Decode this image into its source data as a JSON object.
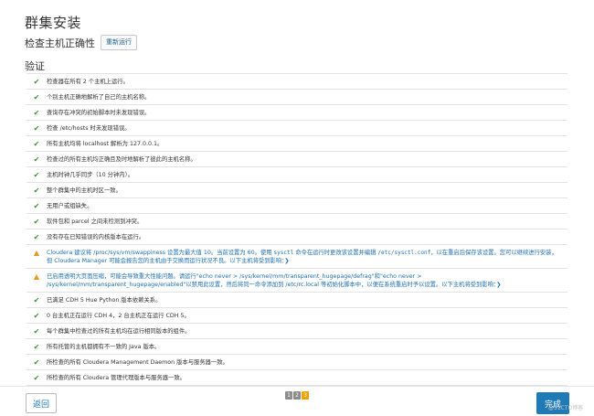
{
  "header": {
    "title": "群集安装",
    "subtitle": "检查主机正确性",
    "rerun_label": "重新运行",
    "section": "验证"
  },
  "checks": [
    {
      "status": "ok",
      "text": "检查器在所有 2 个主机上运行。"
    },
    {
      "status": "ok",
      "text": "个别主机正确地解析了自己的主机名称。"
    },
    {
      "status": "ok",
      "text": "查询存在冲突的初始脚本时未发现错误。"
    },
    {
      "status": "ok",
      "text": "检查 /etc/hosts 时未发现错误。"
    },
    {
      "status": "ok",
      "text": "所有主机均将 localhost 解析为 127.0.0.1。"
    },
    {
      "status": "ok",
      "text": "检查过的所有主机均正确且及时地解析了彼此的主机名称。"
    },
    {
      "status": "ok",
      "text": "主机时钟几乎同步（10 分钟内）。"
    },
    {
      "status": "ok",
      "text": "整个群集中的主机时区一致。"
    },
    {
      "status": "ok",
      "text": "无用户或组缺失。"
    },
    {
      "status": "ok",
      "text": "软件包和 parcel 之间未检测到冲突。"
    },
    {
      "status": "ok",
      "text": "没有存在已知错误的内核版本在运行。"
    },
    {
      "status": "warn",
      "text_a": "Cloudera 建议将 /proc/sys/vm/swappiness 设置为最大值 10。当前设置为 60。使用 ",
      "code_a": "sysctl",
      "text_b": " 命令在运行时更改该设置并编辑 ",
      "code_b": "/etc/sysctl.conf",
      "text_c": "，以在重启后保存该设置。您可以继续进行安装，但 Cloudera Manager 可能会报告您的主机由于交换而运行状况不良。以下主机将受到影响：",
      "more": "❯"
    },
    {
      "status": "warn",
      "text_a": "已启用透明大页面压缩，可能会导致重大性能问题。请运行\"echo never > /sys/kernel/mm/transparent_hugepage/defrag\"和\"echo never > /sys/kernel/mm/transparent_hugepage/enabled\"以禁用此设置，然后将同一命令添加到 /etc/rc.local 等初始化脚本中，以便在系统重启时予以设置。以下主机将受到影响：",
      "more": "❯"
    },
    {
      "status": "ok",
      "text": "已满足 CDH 5 Hue Python 版本依赖关系。"
    },
    {
      "status": "ok",
      "text": "0 台主机正在运行 CDH 4，2 台主机正在运行 CDH 5。"
    },
    {
      "status": "ok",
      "text": "每个群集中检查过的所有主机均在运行相同版本的组件。"
    },
    {
      "status": "ok",
      "text": "所有托管的主机都拥有不一致的 Java 版本。"
    },
    {
      "status": "ok",
      "text": "所检查的所有 Cloudera Management Daemon 版本与服务器一致。"
    },
    {
      "status": "ok",
      "text": "所检查的所有 Cloudera 管理代理版本与服务器一致。"
    }
  ],
  "icons": {
    "ok": "checkmark-icon",
    "warn": "warning-icon"
  },
  "colors": {
    "ok": "#3c8f3c",
    "warn": "#e39a20",
    "link": "#1e6fb0",
    "primary": "#1f7ab5",
    "pager_active": "#f0a000"
  },
  "footer": {
    "back_label": "返回",
    "pages": [
      "1",
      "2",
      "3"
    ],
    "active_page": "3",
    "done_label": "完成",
    "watermark": "@51CTO博客"
  }
}
